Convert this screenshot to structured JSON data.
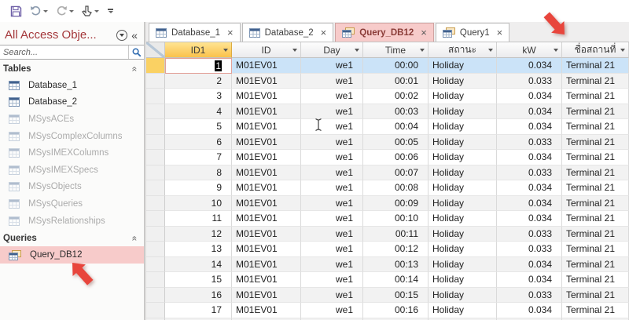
{
  "qat": {
    "buttons": [
      {
        "label": "Save"
      },
      {
        "label": "Undo"
      },
      {
        "label": "Redo"
      },
      {
        "label": "Touch/Mouse Mode"
      },
      {
        "label": "Customize Quick Access Toolbar"
      }
    ]
  },
  "nav": {
    "title": "All Access Obje...",
    "search_placeholder": "Search...",
    "shutter_glyph": "«",
    "groups": [
      {
        "label": "Tables",
        "type": "table",
        "items": [
          {
            "label": "Database_1",
            "muted": false
          },
          {
            "label": "Database_2",
            "muted": false
          },
          {
            "label": "MSysACEs",
            "muted": true
          },
          {
            "label": "MSysComplexColumns",
            "muted": true
          },
          {
            "label": "MSysIMEXColumns",
            "muted": true
          },
          {
            "label": "MSysIMEXSpecs",
            "muted": true
          },
          {
            "label": "MSysObjects",
            "muted": true
          },
          {
            "label": "MSysQueries",
            "muted": true
          },
          {
            "label": "MSysRelationships",
            "muted": true
          }
        ]
      },
      {
        "label": "Queries",
        "type": "query",
        "items": [
          {
            "label": "Query_DB12",
            "muted": false,
            "selected": true
          }
        ]
      }
    ]
  },
  "tabs": [
    {
      "label": "Database_1",
      "icon": "table",
      "active": false
    },
    {
      "label": "Database_2",
      "icon": "table",
      "active": false
    },
    {
      "label": "Query_DB12",
      "icon": "query",
      "active": true
    },
    {
      "label": "Query1",
      "icon": "query",
      "active": false
    }
  ],
  "grid": {
    "columns": [
      "ID1",
      "ID",
      "Day",
      "Time",
      "สถานะ",
      "kW",
      "ชื่อสถานที่"
    ],
    "selection": {
      "row": 1,
      "column": "ID1",
      "cell_value": "1"
    },
    "rows": [
      [
        "1",
        "M01EV01",
        "we1",
        "00:00",
        "Holiday",
        "0.034",
        "Terminal 21"
      ],
      [
        "2",
        "M01EV01",
        "we1",
        "00:01",
        "Holiday",
        "0.033",
        "Terminal 21"
      ],
      [
        "3",
        "M01EV01",
        "we1",
        "00:02",
        "Holiday",
        "0.034",
        "Terminal 21"
      ],
      [
        "4",
        "M01EV01",
        "we1",
        "00:03",
        "Holiday",
        "0.034",
        "Terminal 21"
      ],
      [
        "5",
        "M01EV01",
        "we1",
        "00:04",
        "Holiday",
        "0.034",
        "Terminal 21"
      ],
      [
        "6",
        "M01EV01",
        "we1",
        "00:05",
        "Holiday",
        "0.033",
        "Terminal 21"
      ],
      [
        "7",
        "M01EV01",
        "we1",
        "00:06",
        "Holiday",
        "0.034",
        "Terminal 21"
      ],
      [
        "8",
        "M01EV01",
        "we1",
        "00:07",
        "Holiday",
        "0.033",
        "Terminal 21"
      ],
      [
        "9",
        "M01EV01",
        "we1",
        "00:08",
        "Holiday",
        "0.034",
        "Terminal 21"
      ],
      [
        "10",
        "M01EV01",
        "we1",
        "00:09",
        "Holiday",
        "0.034",
        "Terminal 21"
      ],
      [
        "11",
        "M01EV01",
        "we1",
        "00:10",
        "Holiday",
        "0.034",
        "Terminal 21"
      ],
      [
        "12",
        "M01EV01",
        "we1",
        "00:11",
        "Holiday",
        "0.033",
        "Terminal 21"
      ],
      [
        "13",
        "M01EV01",
        "we1",
        "00:12",
        "Holiday",
        "0.033",
        "Terminal 21"
      ],
      [
        "14",
        "M01EV01",
        "we1",
        "00:13",
        "Holiday",
        "0.034",
        "Terminal 21"
      ],
      [
        "15",
        "M01EV01",
        "we1",
        "00:14",
        "Holiday",
        "0.034",
        "Terminal 21"
      ],
      [
        "16",
        "M01EV01",
        "we1",
        "00:15",
        "Holiday",
        "0.033",
        "Terminal 21"
      ],
      [
        "17",
        "M01EV01",
        "we1",
        "00:16",
        "Holiday",
        "0.034",
        "Terminal 21"
      ]
    ]
  },
  "annotations": {
    "arrows": [
      {
        "name": "arrow-at-query-db12",
        "direction": "up-left"
      },
      {
        "name": "arrow-at-column-headers",
        "direction": "down-right"
      }
    ]
  },
  "colors": {
    "accent_red": "#A4373A",
    "selection_pink": "#F7CBCA",
    "selected_column_gold": "#FAD163",
    "selected_row_blue": "#CBE3F8",
    "annotation_red": "#E8453C"
  }
}
